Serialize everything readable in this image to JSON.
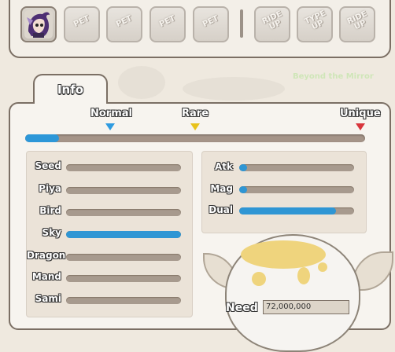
{
  "slots": [
    {
      "label": "",
      "active": true,
      "icon": "character-portrait-icon"
    },
    {
      "label": "PET",
      "active": false
    },
    {
      "label": "PET",
      "active": false
    },
    {
      "label": "PET",
      "active": false
    },
    {
      "label": "PET",
      "active": false
    },
    {
      "label": "RIDE UP",
      "active": false
    },
    {
      "label": "TYPE UP",
      "active": false
    },
    {
      "label": "RIDE UP",
      "active": false
    }
  ],
  "background_text": "Beyond the Mirror",
  "tab": {
    "label": "Info"
  },
  "rarity": {
    "grades": [
      {
        "label": "Normal",
        "marker_color": "#2f9be0"
      },
      {
        "label": "Rare",
        "marker_color": "#e8c21c"
      },
      {
        "label": "Unique",
        "marker_color": "#d8353c"
      }
    ],
    "progress": 0.1
  },
  "types": [
    {
      "label": "Seed",
      "value": 0
    },
    {
      "label": "Piya",
      "value": 0
    },
    {
      "label": "Bird",
      "value": 0
    },
    {
      "label": "Sky",
      "value": 1.0
    },
    {
      "label": "Dragon",
      "value": 0
    },
    {
      "label": "Mand",
      "value": 0
    },
    {
      "label": "Sami",
      "value": 0
    }
  ],
  "stats": [
    {
      "label": "Atk",
      "value": 0.07
    },
    {
      "label": "Mag",
      "value": 0.07
    },
    {
      "label": "Dual",
      "value": 0.84
    }
  ],
  "need": {
    "label": "Need",
    "value": "72,000,000"
  },
  "colors": {
    "accent": "#2f96d4",
    "border": "#7b6f64",
    "panel": "#f7f4ef"
  }
}
